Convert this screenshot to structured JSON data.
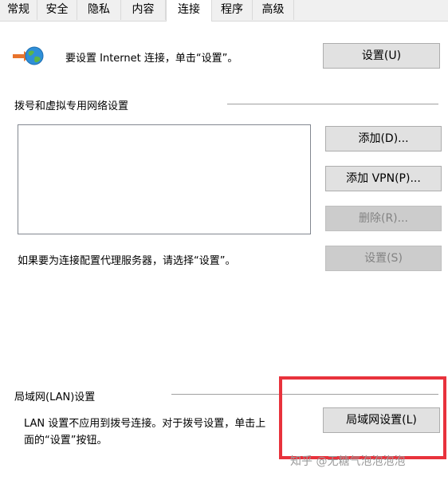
{
  "tabs": [
    {
      "label": "常规"
    },
    {
      "label": "安全"
    },
    {
      "label": "隐私"
    },
    {
      "label": "内容"
    },
    {
      "label": "连接",
      "active": true
    },
    {
      "label": "程序"
    },
    {
      "label": "高级"
    }
  ],
  "internet_setup": {
    "icon": "globe-network-icon",
    "text": "要设置 Internet 连接，单击“设置”。",
    "setup_button": "设置(U)"
  },
  "dialup": {
    "section_title": "拨号和虚拟专用网络设置",
    "add_button": "添加(D)...",
    "add_vpn_button": "添加 VPN(P)...",
    "remove_button": "删除(R)...",
    "proxy_text": "如果要为连接配置代理服务器，请选择“设置”。",
    "settings_button": "设置(S)"
  },
  "lan": {
    "section_title": "局域网(LAN)设置",
    "description_line1": "LAN 设置不应用到拨号连接。对于拨号设置，单击上",
    "description_line2": "面的“设置”按钮。",
    "lan_settings_button": "局域网设置(L)"
  },
  "annotation": {
    "highlight_color": "#e8323c"
  },
  "watermark": {
    "text": "知乎 @无糖气泡泡泡泡"
  }
}
